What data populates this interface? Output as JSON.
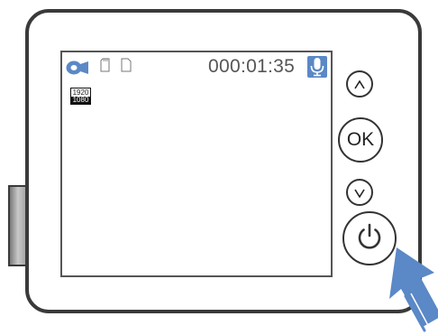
{
  "screen": {
    "timer": "000:01:35",
    "resolution_top": "1920",
    "resolution_bottom": "1080",
    "icons": {
      "mode": "video-camera-icon",
      "storage_1": "sd-card-icon",
      "storage_2": "sd-card-icon",
      "audio": "microphone-icon"
    }
  },
  "controls": {
    "up_label": "^",
    "ok_label": "OK",
    "down_label": "v",
    "power_icon": "power-icon"
  },
  "colors": {
    "accent": "#5b88c6",
    "outline": "#3a3a3a"
  }
}
